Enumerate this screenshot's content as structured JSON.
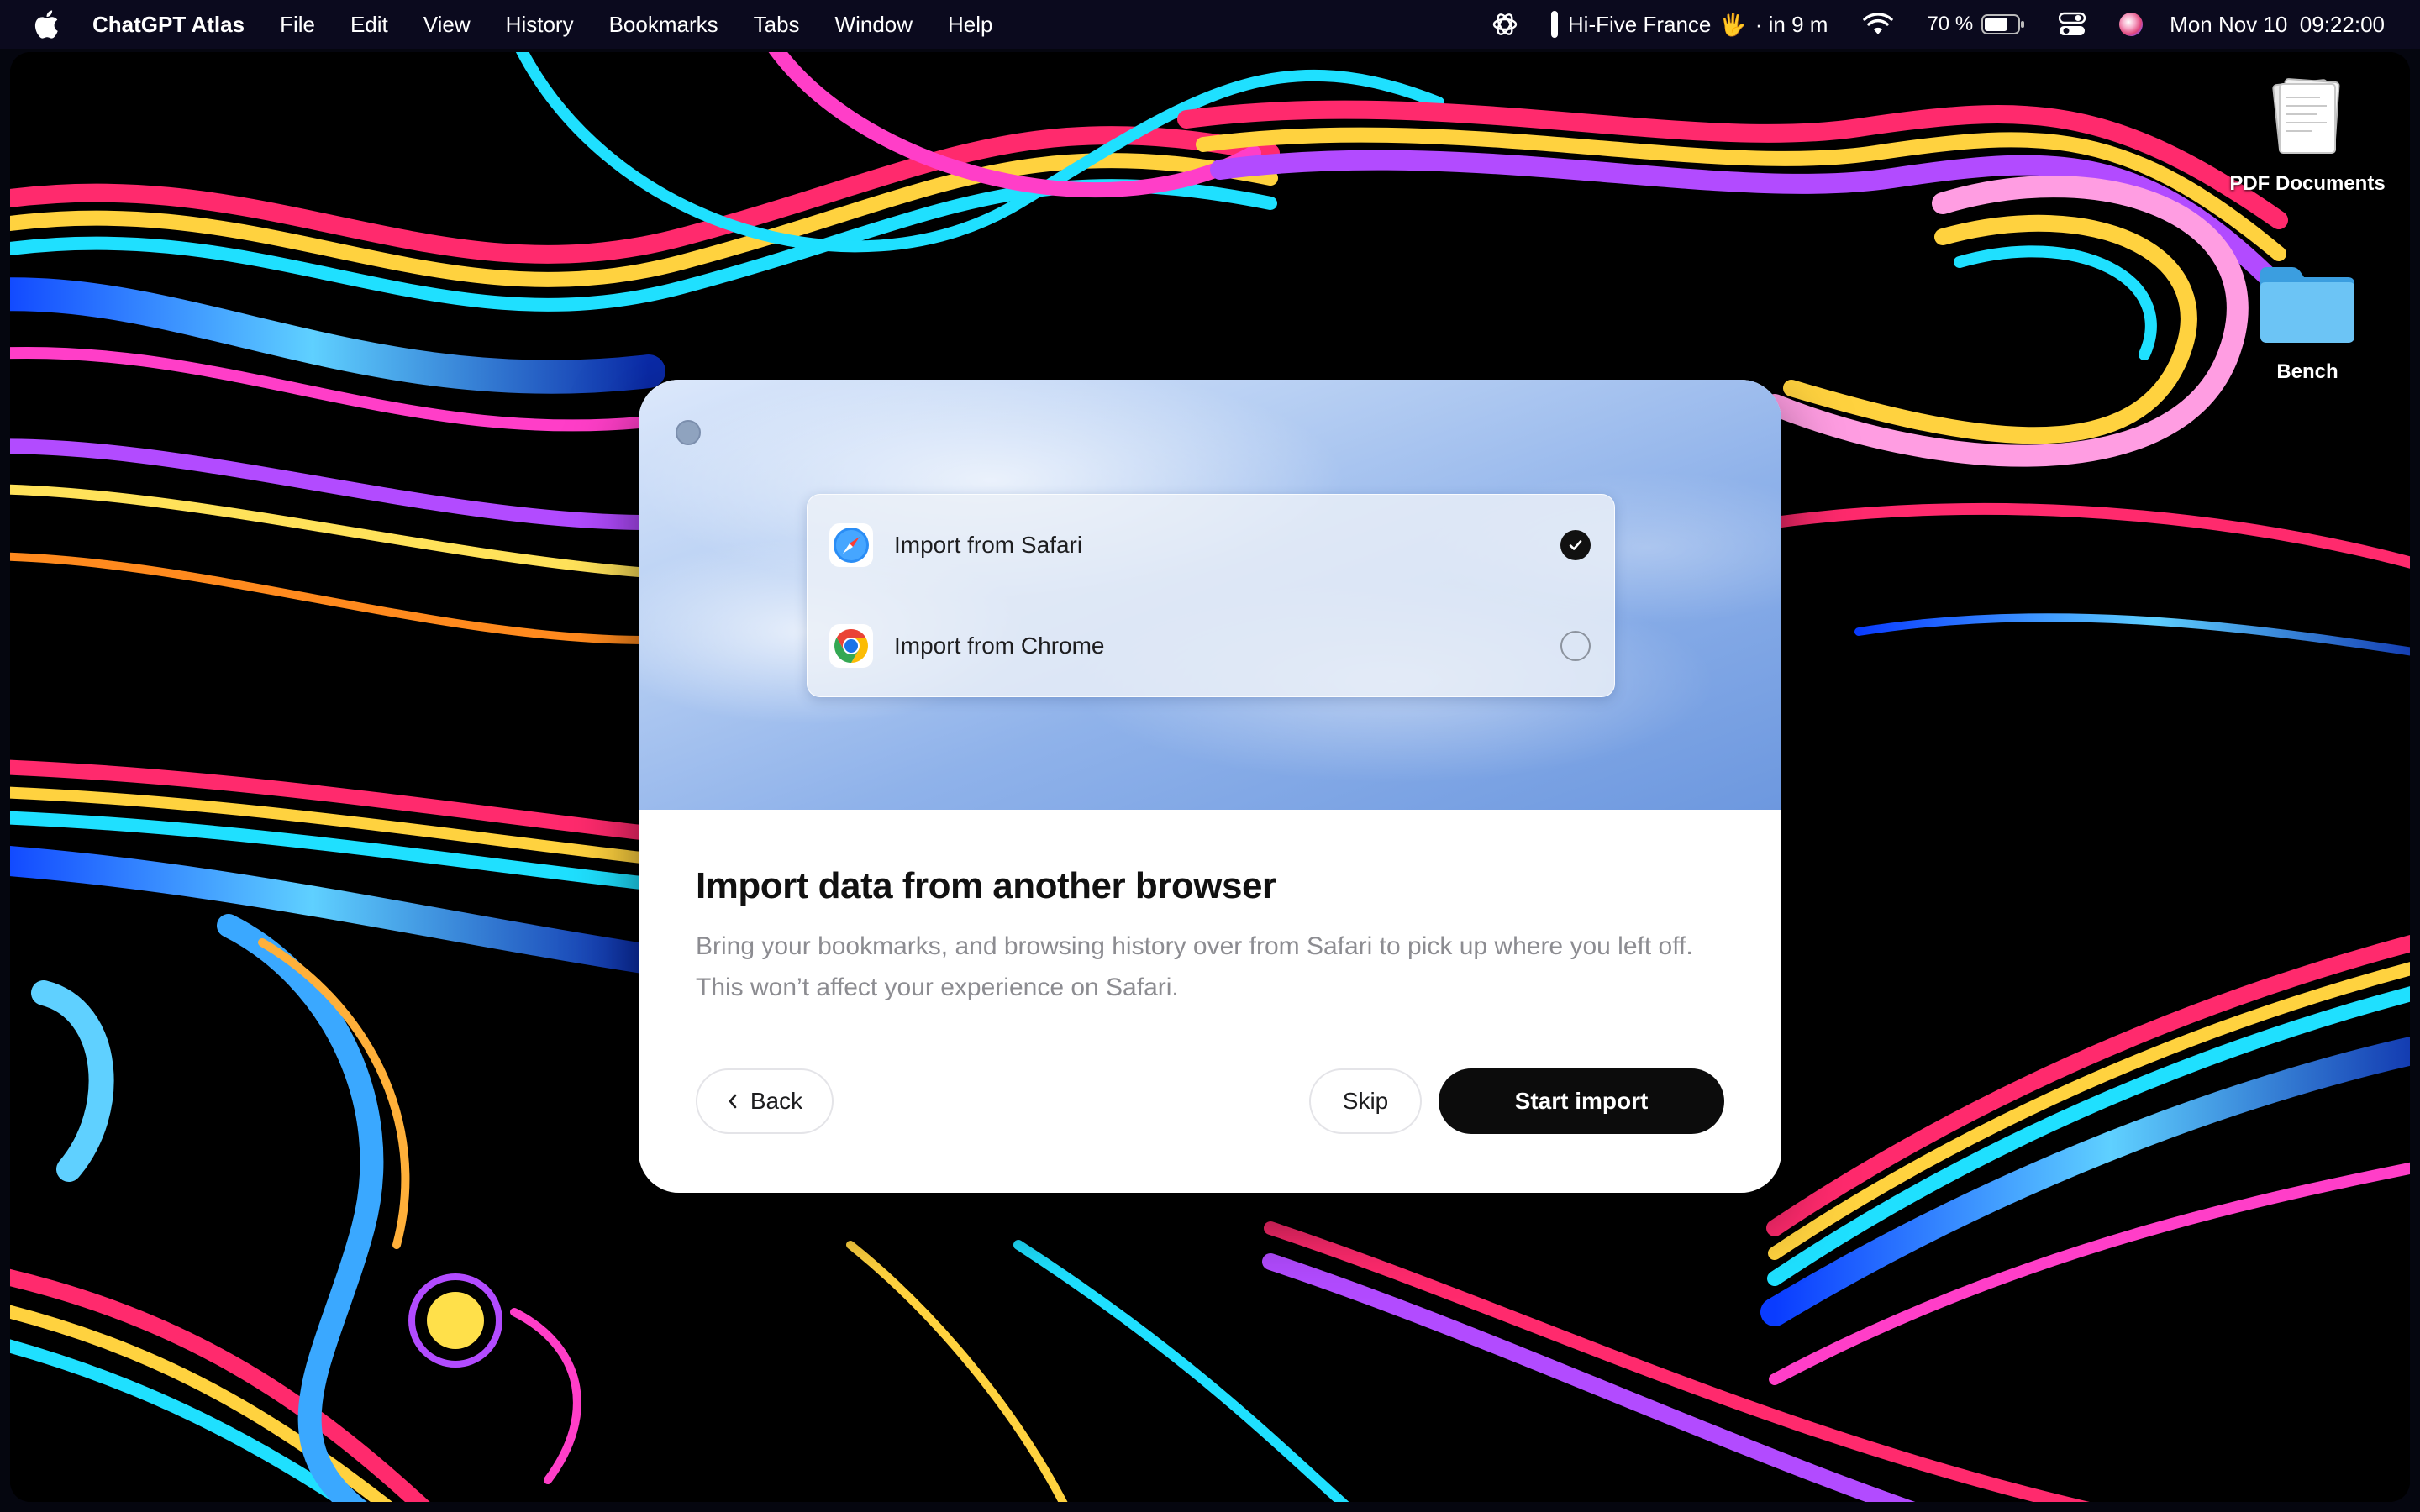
{
  "menubar": {
    "app_name": "ChatGPT Atlas",
    "menus": [
      "File",
      "Edit",
      "View",
      "History",
      "Bookmarks",
      "Tabs",
      "Window",
      "Help"
    ],
    "event_text": "Hi-Five France",
    "event_emoji": "🖐",
    "event_time": "· in 9 m",
    "battery_percent": "70 %",
    "battery_level": 0.7,
    "datetime": "Mon Nov 10  09:22:00"
  },
  "desktop": {
    "icons": [
      {
        "label": "PDF Documents",
        "icon": "document-stack-icon"
      },
      {
        "label": "Bench",
        "icon": "folder-icon"
      }
    ]
  },
  "dialog": {
    "options": [
      {
        "label": "Import from Safari",
        "icon": "safari-icon",
        "selected": true
      },
      {
        "label": "Import from Chrome",
        "icon": "chrome-icon",
        "selected": false
      }
    ],
    "title": "Import data from another browser",
    "description": "Bring your bookmarks, and browsing history over from Safari to pick up where you left off. This won’t affect your experience on Safari.",
    "back_label": "Back",
    "skip_label": "Skip",
    "start_label": "Start import"
  },
  "colors": {
    "primary_button": "#0c0c0c",
    "menubar_bg": "#0b0a1e",
    "hero_blue": "#6d98df"
  }
}
